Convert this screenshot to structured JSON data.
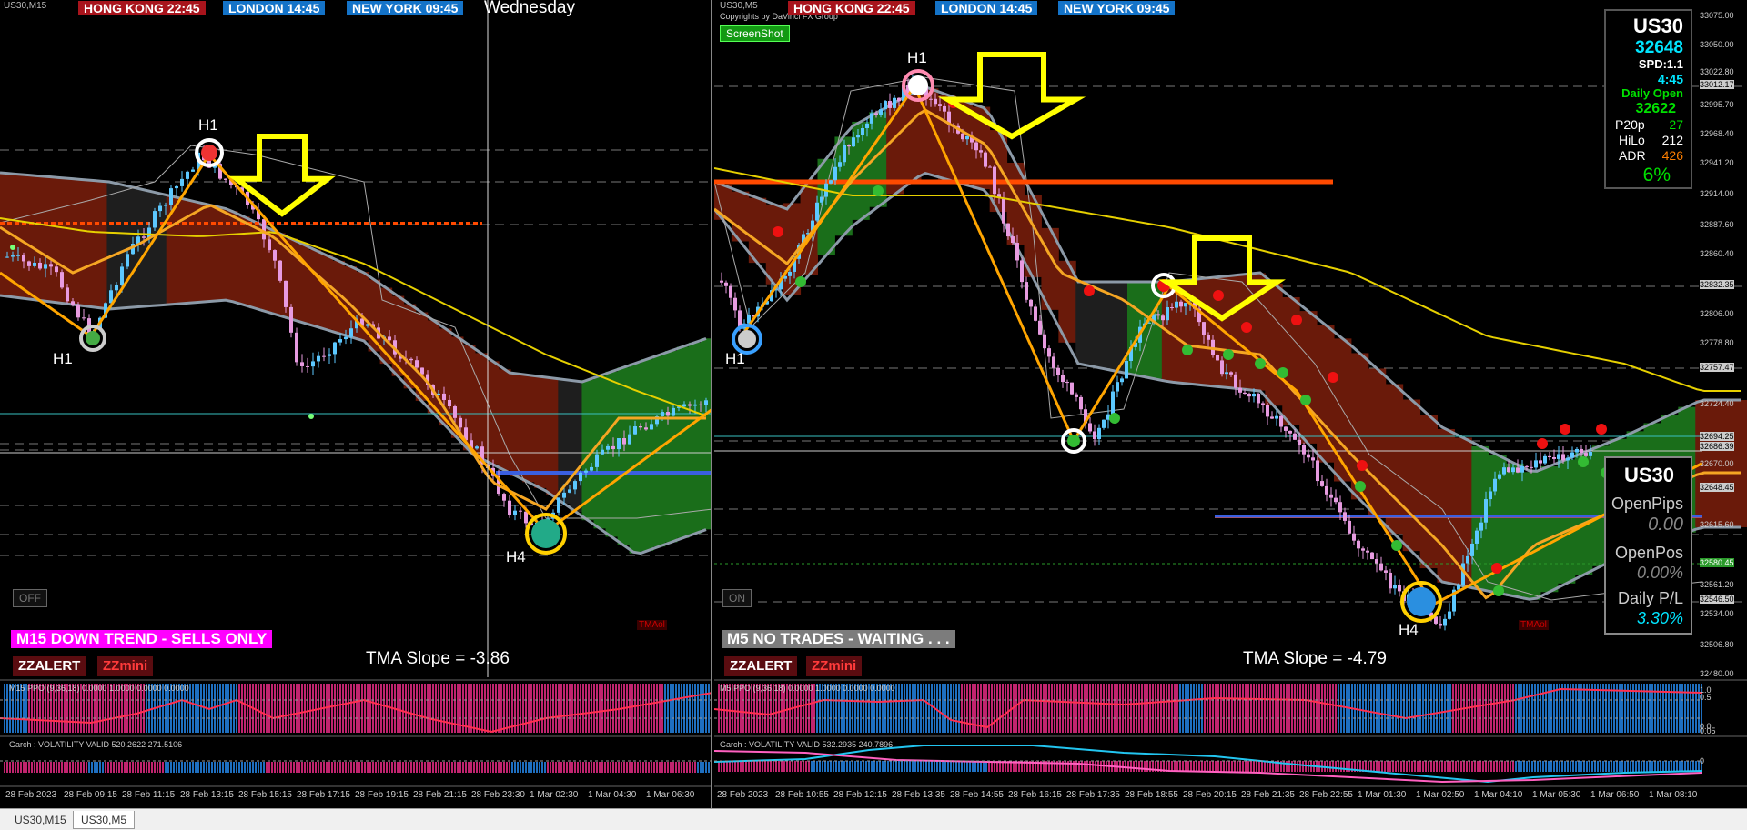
{
  "left": {
    "symbol": "US30,M15",
    "clocks": {
      "hongkong": "HONG KONG 22:45",
      "london": "LONDON  14:45",
      "newyork": "NEW YORK 09:45"
    },
    "weekday": "Wednesday",
    "labels": {
      "h1_top": "H1",
      "h1_bottom": "H1",
      "h4": "H4"
    },
    "toggle": "OFF",
    "banner": "M15  DOWN TREND - SELLS ONLY",
    "slope": "TMA Slope = -3.86",
    "zzalert": "ZZALERT",
    "zzmini": "ZZmini",
    "tmaol": "TMAol",
    "ppo_label": "M15 PPO (9,36,18) 0.0000  1.0000 0.0000 0.0000",
    "garch_label": "Garch : VOLATILITY VALID 520.2622 271.5106",
    "time_labels": [
      "28 Feb 2023",
      "28 Feb 09:15",
      "28 Feb 11:15",
      "28 Feb 13:15",
      "28 Feb 15:15",
      "28 Feb 17:15",
      "28 Feb 19:15",
      "28 Feb 21:15",
      "28 Feb 23:30",
      "1 Mar 02:30",
      "1 Mar 04:30",
      "1 Mar 06:30"
    ]
  },
  "right": {
    "symbol": "US30,M5",
    "copyright": "Copyrights by DaVinci FX Group",
    "screenshot_button": "ScreenShot",
    "clocks": {
      "hongkong": "HONG KONG 22:45",
      "london": "LONDON  14:45",
      "newyork": "NEW YORK 09:45"
    },
    "labels": {
      "h1_top": "H1",
      "h1_bottom": "H1",
      "h4": "H4"
    },
    "toggle": "ON",
    "banner": "M5  NO TRADES - WAITING . . .",
    "slope": "TMA Slope = -4.79",
    "zzalert": "ZZALERT",
    "zzmini": "ZZmini",
    "tmaol": "TMAol",
    "ppo_label": "M5 PPO (9,36,18) 0.0000  1.0000 0.0000 0.0000",
    "garch_label": "Garch : VOLATILITY VALID 532.2935 240.7896",
    "time_labels": [
      "28 Feb 2023",
      "28 Feb 10:55",
      "28 Feb 12:15",
      "28 Feb 13:35",
      "28 Feb 14:55",
      "28 Feb 16:15",
      "28 Feb 17:35",
      "28 Feb 18:55",
      "28 Feb 20:15",
      "28 Feb 21:35",
      "28 Feb 22:55",
      "1 Mar 01:30",
      "1 Mar 02:50",
      "1 Mar 04:10",
      "1 Mar 05:30",
      "1 Mar 06:50",
      "1 Mar 08:10"
    ]
  },
  "info_top": {
    "symbol": "US30",
    "price": "32648",
    "spread": "SPD:1.1",
    "timer": "4:45",
    "daily_open_label": "Daily Open",
    "daily_open": "32622",
    "p20_label": "P20p",
    "p20": "27",
    "hilo_label": "HiLo",
    "hilo": "212",
    "adr_label": "ADR",
    "adr": "426",
    "adr_pct": "6%"
  },
  "info_bottom": {
    "symbol": "US30",
    "open_pips_label": "OpenPips",
    "open_pips": "0.00",
    "open_pos_label": "OpenPos",
    "open_pos": "0.00%",
    "daily_pl_label": "Daily P/L",
    "daily_pl": "3.30%"
  },
  "price_axis": [
    "33075.00",
    "33050.00",
    "33022.80",
    "33012.17",
    "32995.70",
    "32968.40",
    "32941.20",
    "32914.00",
    "32887.60",
    "32860.40",
    "32832.35",
    "32806.00",
    "32778.80",
    "32757.47",
    "32724.40",
    "32694.25",
    "32686.39",
    "32670.00",
    "32648.45",
    "32615.60",
    "32580.45",
    "32561.20",
    "32546.50",
    "32534.00",
    "32506.80",
    "32480.00"
  ],
  "ind_axis": [
    "1.0",
    "0.5",
    "0.0",
    "0.05",
    "0"
  ],
  "tabs": [
    "US30,M15",
    "US30,M5"
  ],
  "colors": {
    "bull": "#1a7a1a",
    "bear": "#6a1a0a",
    "tma": "#f5a623",
    "ma": "#e6d000",
    "ppo_bull": "#1e6fc0",
    "ppo_bear": "#c0246e",
    "arrow": "#ffff00",
    "level": "#ff4a00"
  }
}
